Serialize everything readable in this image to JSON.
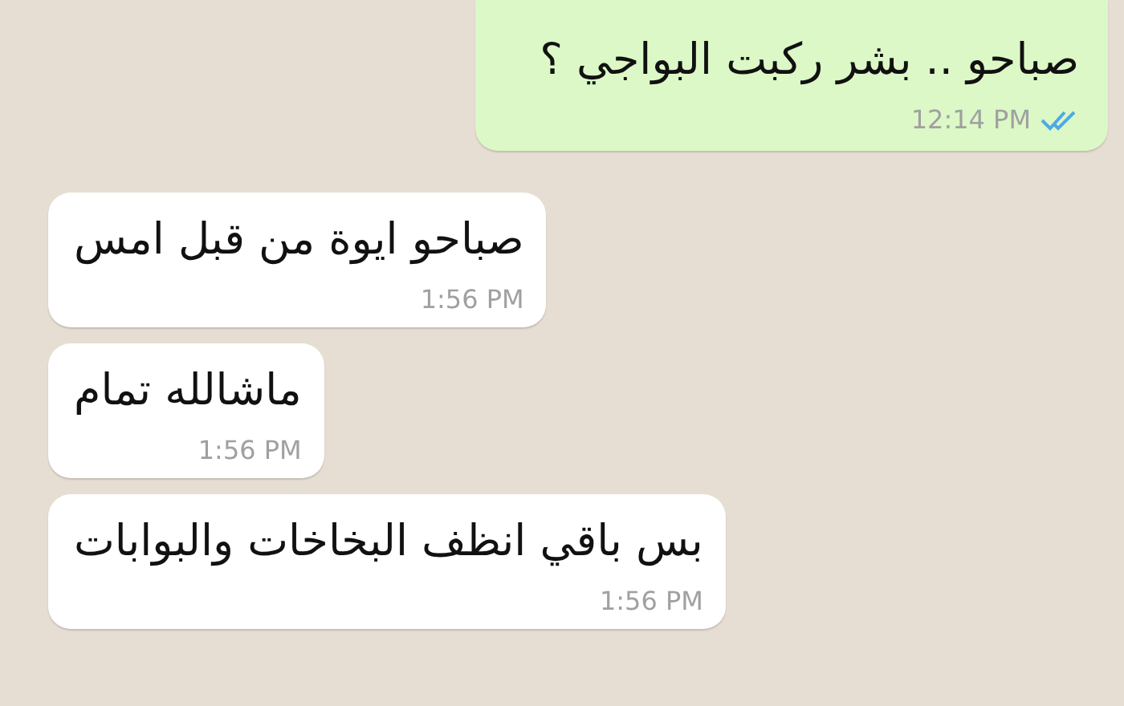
{
  "messages": [
    {
      "kind": "outgoing",
      "text": "صباحو .. بشر ركبت البواجي ؟",
      "time": "12:14 PM",
      "read": true
    },
    {
      "kind": "incoming",
      "text": "صباحو ايوة من قبل امس",
      "time": "1:56 PM"
    },
    {
      "kind": "incoming",
      "text": "ماشالله تمام",
      "time": "1:56 PM"
    },
    {
      "kind": "incoming",
      "text": "بس باقي انظف البخاخات والبوابات",
      "time": "1:56 PM"
    }
  ]
}
